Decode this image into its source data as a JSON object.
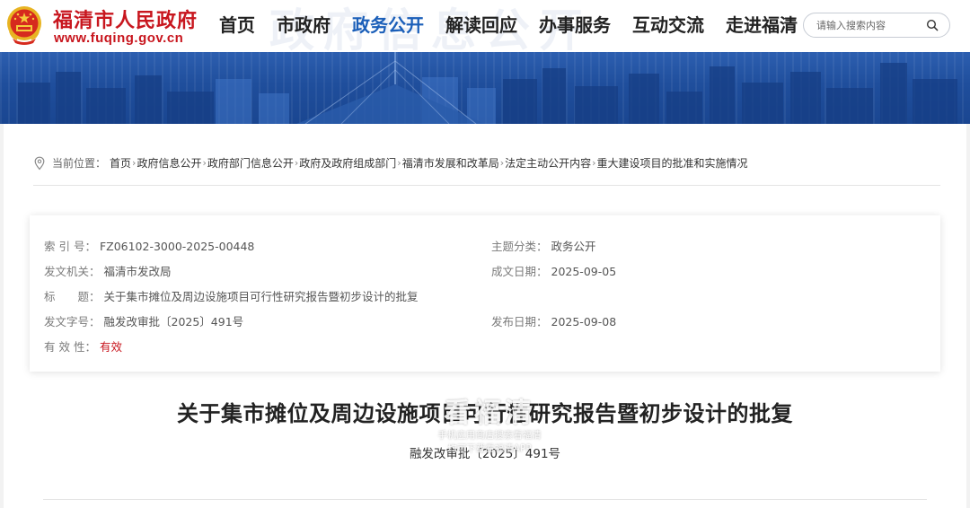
{
  "header": {
    "site_name": "福清市人民政府",
    "site_url": "www.fuqing.gov.cn",
    "bg_text": "政府信息公开",
    "nav": [
      {
        "label": "首页",
        "active": false
      },
      {
        "label": "市政府",
        "active": false
      },
      {
        "label": "政务公开",
        "active": true
      },
      {
        "label": "解读回应",
        "active": false
      },
      {
        "label": "办事服务",
        "active": false
      },
      {
        "label": "互动交流",
        "active": false
      },
      {
        "label": "走进福清",
        "active": false
      }
    ],
    "search": {
      "placeholder": "请输入搜索内容",
      "value": ""
    }
  },
  "breadcrumb": {
    "prefix": "当前位置：",
    "separator": "›",
    "items": [
      "首页",
      "政府信息公开",
      "政府部门信息公开",
      "政府及政府组成部门",
      "福清市发展和改革局",
      "法定主动公开内容",
      "重大建设项目的批准和实施情况"
    ]
  },
  "meta": {
    "index_label": "索 引 号：",
    "index_value": "FZ06102-3000-2025-00448",
    "topic_label": "主题分类：",
    "topic_value": "政务公开",
    "issuer_label": "发文机关：",
    "issuer_value": "福清市发改局",
    "created_label": "成文日期：",
    "created_value": "2025-09-05",
    "title_label": "标　　题：",
    "title_value": "关于集市摊位及周边设施项目可行性研究报告暨初步设计的批复",
    "docno_label": "发文字号：",
    "docno_value": "融发改审批〔2025〕491号",
    "published_label": "发布日期：",
    "published_value": "2025-09-08",
    "validity_label": "有 效 性：",
    "validity_value": "有效"
  },
  "document": {
    "title": "关于集市摊位及周边设施项目可行性研究报告暨初步设计的批复",
    "number": "融发改审批〔2025〕491号"
  },
  "watermark": {
    "big": "看福清",
    "line1": "手机应用商店搜索看福清",
    "line2": "均可下载看福清APP"
  },
  "colors": {
    "brand_red": "#c8161e",
    "nav_active_blue": "#1b5fb9",
    "banner_blue": "#1f4e9c"
  }
}
